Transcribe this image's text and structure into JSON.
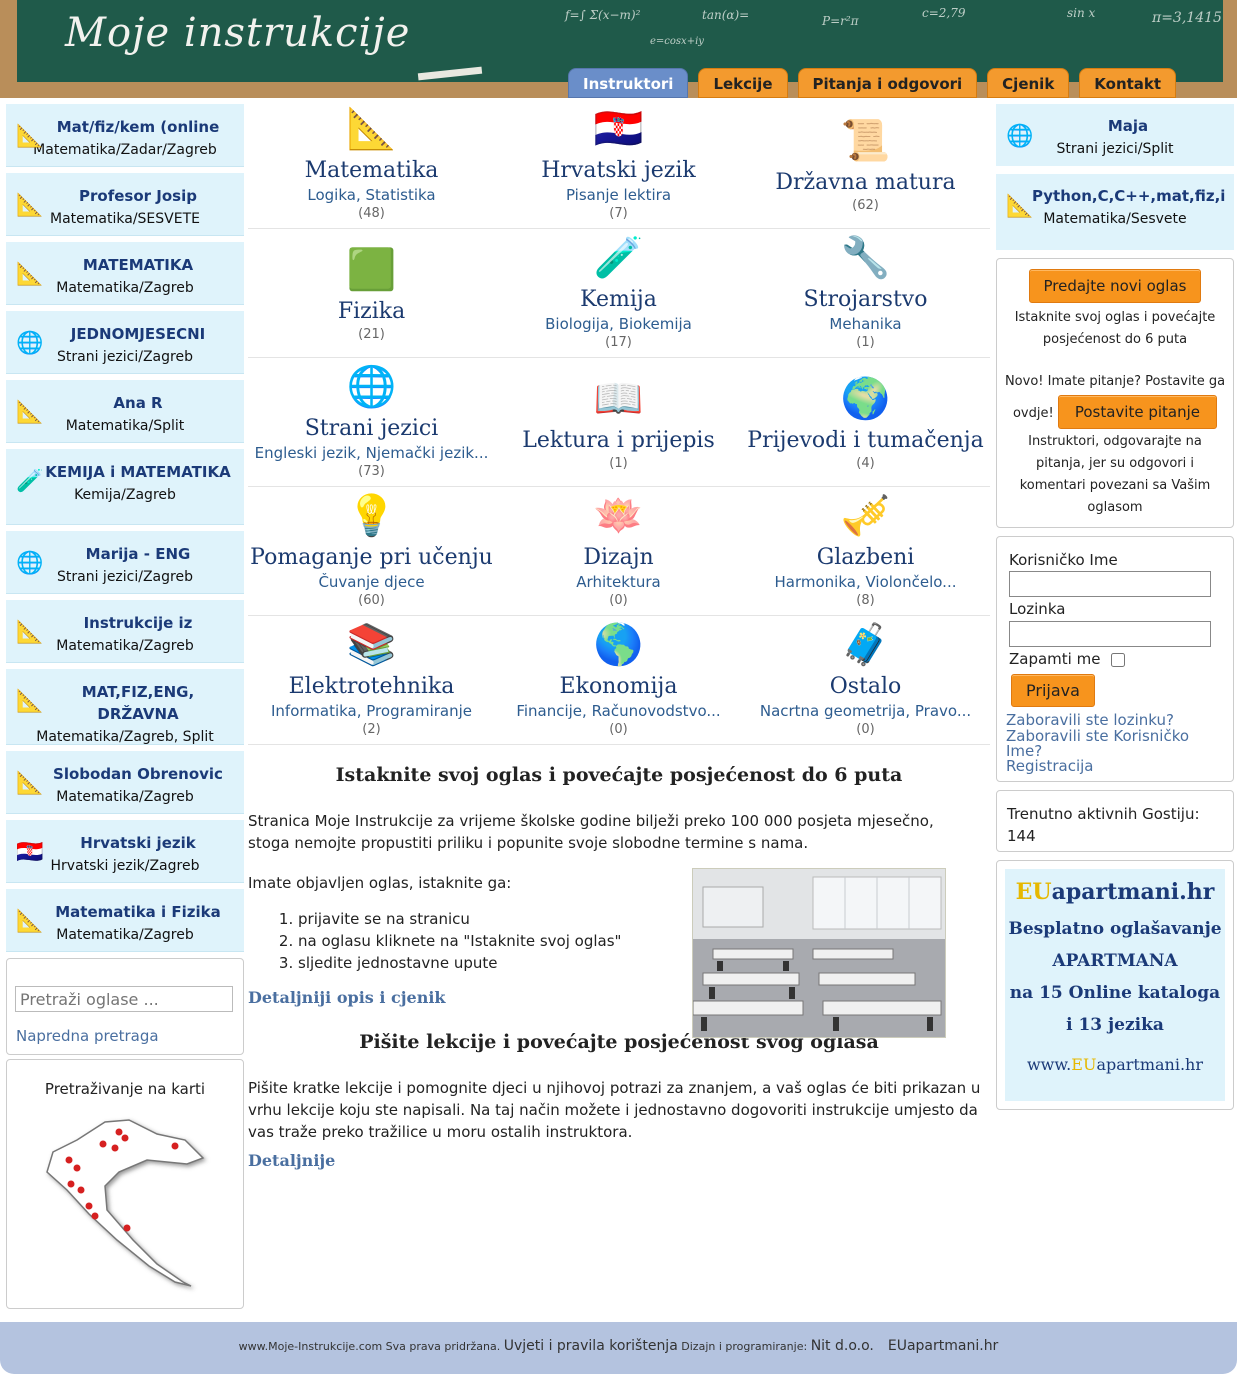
{
  "site": {
    "logo": "Moje instrukcije",
    "formulas": [
      "f=∫ Σ(x−m)²",
      "tan(α)=",
      "P=r²π",
      "c=2,79",
      "sin x",
      "π=3,1415",
      "e=cosx+iy"
    ]
  },
  "nav": [
    "Instruktori",
    "Lekcije",
    "Pitanja i odgovori",
    "Cjenik",
    "Kontakt"
  ],
  "left_ads": [
    {
      "title": "Mat/fiz/kem (online",
      "sub": "Matematika/Zadar/Zagreb",
      "icon": "math-tools-icon"
    },
    {
      "title": "Profesor Josip",
      "sub": "Matematika/SESVETE",
      "icon": "math-tools-icon"
    },
    {
      "title": "MATEMATIKA",
      "sub": "Matematika/Zagreb",
      "icon": "math-tools-icon"
    },
    {
      "title": "JEDNOMJESECNI",
      "sub": "Strani jezici/Zagreb",
      "icon": "globe-icon"
    },
    {
      "title": "Ana R",
      "sub": "Matematika/Split",
      "icon": "math-tools-icon"
    },
    {
      "title": "KEMIJA i MATEMATIKA",
      "sub": "Kemija/Zagreb",
      "icon": "flask-icon"
    },
    {
      "title": "Marija - ENG",
      "sub": "Strani jezici/Zagreb",
      "icon": "globe-icon"
    },
    {
      "title": "Instrukcije iz",
      "sub": "Matematika/Zagreb",
      "icon": "math-tools-icon"
    },
    {
      "title": "MAT,FIZ,ENG, DRŽAVNA",
      "sub": "Matematika/Zagreb, Split",
      "icon": "math-tools-icon"
    },
    {
      "title": "Slobodan Obrenovic",
      "sub": "Matematika/Zagreb",
      "icon": "math-tools-icon"
    },
    {
      "title": "Hrvatski jezik",
      "sub": "Hrvatski jezik/Zagreb",
      "icon": "croatia-flag-icon"
    },
    {
      "title": "Matematika i Fizika",
      "sub": "Matematika/Zagreb",
      "icon": "math-tools-icon"
    }
  ],
  "search": {
    "placeholder": "Pretraži oglase ...",
    "advanced": "Napredna pretraga"
  },
  "map": {
    "title": "Pretraživanje na karti"
  },
  "categories": [
    {
      "name": "Matematika",
      "sub": "Logika, Statistika",
      "count": "(48)",
      "icon": "math-tools-icon"
    },
    {
      "name": "Hrvatski jezik",
      "sub": "Pisanje lektira",
      "count": "(7)",
      "icon": "croatia-flag-icon"
    },
    {
      "name": "Državna matura",
      "sub": "",
      "count": "(62)",
      "icon": "diploma-icon"
    },
    {
      "name": "Fizika",
      "sub": "",
      "count": "(21)",
      "icon": "blackboard-icon"
    },
    {
      "name": "Kemija",
      "sub": "Biologija, Biokemija",
      "count": "(17)",
      "icon": "flask-icon"
    },
    {
      "name": "Strojarstvo",
      "sub": "Mehanika",
      "count": "(1)",
      "icon": "tools-icon"
    },
    {
      "name": "Strani jezici",
      "sub": "Engleski jezik, Njemački jezik...",
      "count": "(73)",
      "icon": "globe-icon"
    },
    {
      "name": "Lektura i prijepis",
      "sub": "",
      "count": "(1)",
      "icon": "book-icon"
    },
    {
      "name": "Prijevodi i tumačenja",
      "sub": "",
      "count": "(4)",
      "icon": "earth-icon"
    },
    {
      "name": "Pomaganje pri učenju",
      "sub": "Čuvanje djece",
      "count": "(60)",
      "icon": "lightbulb-icon"
    },
    {
      "name": "Dizajn",
      "sub": "Arhitektura",
      "count": "(0)",
      "icon": "lotus-icon"
    },
    {
      "name": "Glazbeni",
      "sub": "Harmonika, Violončelo...",
      "count": "(8)",
      "icon": "trumpet-icon"
    },
    {
      "name": "Elektrotehnika",
      "sub": "Informatika, Programiranje",
      "count": "(2)",
      "icon": "books-glasses-icon"
    },
    {
      "name": "Ekonomija",
      "sub": "Financije, Računovodstvo...",
      "count": "(0)",
      "icon": "world-icon"
    },
    {
      "name": "Ostalo",
      "sub": "Nacrtna geometrija, Pravo...",
      "count": "(0)",
      "icon": "suitcase-icon"
    }
  ],
  "promo": {
    "title1": "Istaknite svoj oglas i povećajte posjećenost do 6 puta",
    "p1": "Stranica Moje Instrukcije za vrijeme školske godine bilježi preko 100 000 posjeta mjesečno, stoga nemojte propustiti priliku i popunite svoje slobodne termine s nama.",
    "p2": "Imate objavljen oglas, istaknite ga:",
    "steps": [
      "prijavite se na stranicu",
      "na oglasu kliknete na \"Istaknite svoj oglas\"",
      "sljedite jednostavne upute"
    ],
    "link1": "Detaljniji opis i cjenik",
    "title2": "Pišite lekcije i povećajte posjećenost svog oglasa",
    "p3": "Pišite kratke lekcije i pomognite djeci u njihovoj potrazi za znanjem, a vaš oglas će biti prikazan u vrhu lekcije koju ste napisali. Na taj način možete i jednostavno dogovoriti instrukcije umjesto da vas traže preko tražilice u moru ostalih instruktora.",
    "link2": "Detaljnije"
  },
  "right_ads": [
    {
      "title": "Maja",
      "sub": "Strani jezici/Split",
      "icon": "globe-icon"
    },
    {
      "title": "Python,C,C++,mat,fiz,i",
      "sub": "Matematika/Sesvete",
      "icon": "math-tools-icon"
    }
  ],
  "ads_box": {
    "new_ad": "Predajte novi oglas",
    "text1": "Istaknite svoj oglas i povećajte posjećenost do 6 puta",
    "text2a": "Novo! Imate pitanje? Postavite ga",
    "text2b": "ovdje!",
    "ask": "Postavite pitanje",
    "text3": "Instruktori, odgovarajte na pitanja, jer su odgovori i komentari povezani sa Vašim oglasom"
  },
  "login": {
    "user_label": "Korisničko Ime",
    "pass_label": "Lozinka",
    "remember": "Zapamti me",
    "submit": "Prijava",
    "forgot_pass": "Zaboravili ste lozinku?",
    "forgot_user": "Zaboravili ste Korisničko Ime?",
    "register": "Registracija"
  },
  "guests": {
    "label": "Trenutno aktivnih Gostiju:",
    "count": "144"
  },
  "eu": {
    "brand_a": "EU",
    "brand_b": "apartmani.hr",
    "l1": "Besplatno oglašavanje",
    "l2": "APARTMANA",
    "l3": "na 15 Online kataloga",
    "l4": "i 13 jezika",
    "url_a": "www.",
    "url_b": "EU",
    "url_c": "apartmani.hr"
  },
  "footer": {
    "copy": "www.Moje-Instrukcije.com Sva prava pridržana.",
    "terms": "Uvjeti i pravila korištenja",
    "design": "Dizajn i programiranje:",
    "company": "Nit d.o.o.",
    "eu": "EUapartmani.hr"
  },
  "colors": {
    "accent": "#f7941d",
    "nav_active": "#6a8ec9",
    "card_bg": "#dff3fb",
    "title_blue": "#1b3a6f",
    "board": "#1f5a4a"
  }
}
